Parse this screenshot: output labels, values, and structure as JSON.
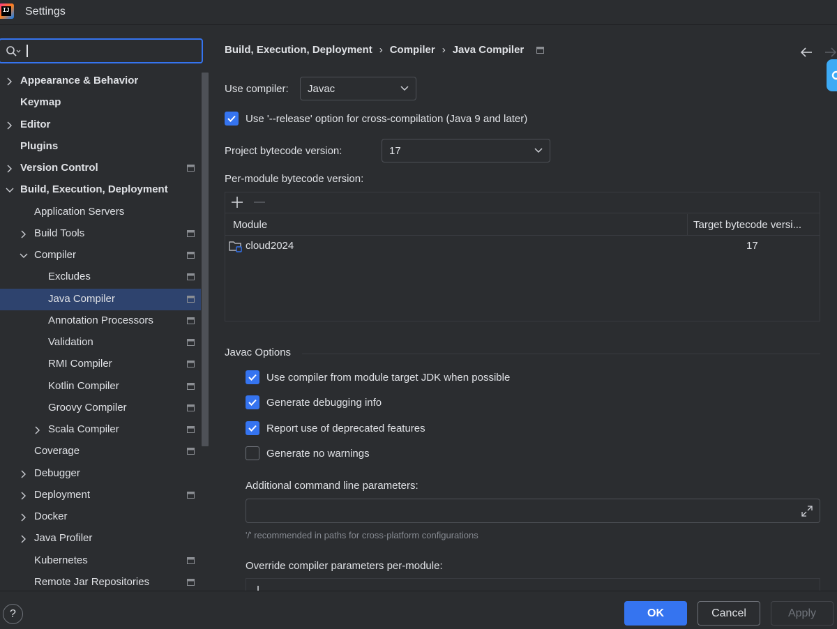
{
  "window": {
    "title": "Settings"
  },
  "search": {
    "placeholder": ""
  },
  "tree": [
    {
      "label": "Appearance & Behavior",
      "bold": true,
      "chevron": "right",
      "indent": 0,
      "project": false
    },
    {
      "label": "Keymap",
      "bold": true,
      "chevron": "",
      "indent": 0,
      "project": false
    },
    {
      "label": "Editor",
      "bold": true,
      "chevron": "right",
      "indent": 0,
      "project": false
    },
    {
      "label": "Plugins",
      "bold": true,
      "chevron": "",
      "indent": 0,
      "project": false
    },
    {
      "label": "Version Control",
      "bold": true,
      "chevron": "right",
      "indent": 0,
      "project": true
    },
    {
      "label": "Build, Execution, Deployment",
      "bold": true,
      "chevron": "down",
      "indent": 0,
      "project": false
    },
    {
      "label": "Application Servers",
      "bold": false,
      "chevron": "",
      "indent": 1,
      "project": false
    },
    {
      "label": "Build Tools",
      "bold": false,
      "chevron": "right",
      "indent": 1,
      "project": true
    },
    {
      "label": "Compiler",
      "bold": false,
      "chevron": "down",
      "indent": 1,
      "project": true
    },
    {
      "label": "Excludes",
      "bold": false,
      "chevron": "",
      "indent": 2,
      "project": true
    },
    {
      "label": "Java Compiler",
      "bold": false,
      "chevron": "",
      "indent": 2,
      "project": true,
      "selected": true
    },
    {
      "label": "Annotation Processors",
      "bold": false,
      "chevron": "",
      "indent": 2,
      "project": true
    },
    {
      "label": "Validation",
      "bold": false,
      "chevron": "",
      "indent": 2,
      "project": true
    },
    {
      "label": "RMI Compiler",
      "bold": false,
      "chevron": "",
      "indent": 2,
      "project": true
    },
    {
      "label": "Kotlin Compiler",
      "bold": false,
      "chevron": "",
      "indent": 2,
      "project": true
    },
    {
      "label": "Groovy Compiler",
      "bold": false,
      "chevron": "",
      "indent": 2,
      "project": true
    },
    {
      "label": "Scala Compiler",
      "bold": false,
      "chevron": "right",
      "indent": 2,
      "project": true
    },
    {
      "label": "Coverage",
      "bold": false,
      "chevron": "",
      "indent": 1,
      "project": true
    },
    {
      "label": "Debugger",
      "bold": false,
      "chevron": "right",
      "indent": 1,
      "project": false
    },
    {
      "label": "Deployment",
      "bold": false,
      "chevron": "right",
      "indent": 1,
      "project": true
    },
    {
      "label": "Docker",
      "bold": false,
      "chevron": "right",
      "indent": 1,
      "project": false
    },
    {
      "label": "Java Profiler",
      "bold": false,
      "chevron": "right",
      "indent": 1,
      "project": false
    },
    {
      "label": "Kubernetes",
      "bold": false,
      "chevron": "",
      "indent": 1,
      "project": true
    },
    {
      "label": "Remote Jar Repositories",
      "bold": false,
      "chevron": "",
      "indent": 1,
      "project": true
    }
  ],
  "breadcrumb": [
    "Build, Execution, Deployment",
    "Compiler",
    "Java Compiler"
  ],
  "breadcrumb_sep": "›",
  "use_compiler": {
    "label": "Use compiler:",
    "value": "Javac"
  },
  "release_option": {
    "label": "Use '--release' option for cross-compilation (Java 9 and later)",
    "checked": true
  },
  "project_bytecode": {
    "label": "Project bytecode version:",
    "value": "17"
  },
  "per_module": {
    "label": "Per-module bytecode version:",
    "columns": [
      "Module",
      "Target bytecode versi..."
    ],
    "rows": [
      {
        "module": "cloud2024",
        "target": "17"
      }
    ]
  },
  "javac_options": {
    "title": "Javac Options",
    "options": [
      {
        "label": "Use compiler from module target JDK when possible",
        "checked": true
      },
      {
        "label": "Generate debugging info",
        "checked": true
      },
      {
        "label": "Report use of deprecated features",
        "checked": true
      },
      {
        "label": "Generate no warnings",
        "checked": false
      }
    ],
    "additional_label": "Additional command line parameters:",
    "additional_value": "",
    "hint": "'/' recommended in paths for cross-platform configurations",
    "override_label": "Override compiler parameters per-module:"
  },
  "buttons": {
    "help": "?",
    "ok": "OK",
    "cancel": "Cancel",
    "apply": "Apply"
  },
  "colors": {
    "accent": "#3574f0",
    "selection": "#2e436e",
    "background": "#2b2d30"
  }
}
